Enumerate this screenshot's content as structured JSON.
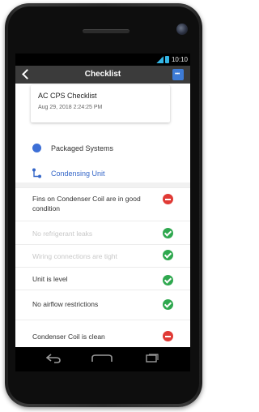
{
  "status_bar": {
    "time": "10:10"
  },
  "app_bar": {
    "title": "Checklist",
    "menu_label": "•••"
  },
  "card": {
    "title": "AC CPS Checklist",
    "date": "Aug 29, 2018 2:24:25 PM"
  },
  "hierarchy": [
    {
      "label": "Packaged Systems"
    },
    {
      "label": "Condensing Unit"
    }
  ],
  "checklist": [
    {
      "label": "Fins on Condenser Coil are in good condition",
      "status": "fail"
    },
    {
      "label": "No refrigerant leaks",
      "status": "pass"
    },
    {
      "label": "Wiring connections are tight",
      "status": "pass"
    },
    {
      "label": "Unit is level",
      "status": "pass"
    },
    {
      "label": "No airflow restrictions",
      "status": "pass"
    },
    {
      "label": "Condenser Coil is clean",
      "status": "fail"
    }
  ],
  "colors": {
    "pass": "#2fa84f",
    "fail": "#e03a35",
    "accent": "#3d7bd6",
    "app_bar": "#3b3b3b"
  }
}
